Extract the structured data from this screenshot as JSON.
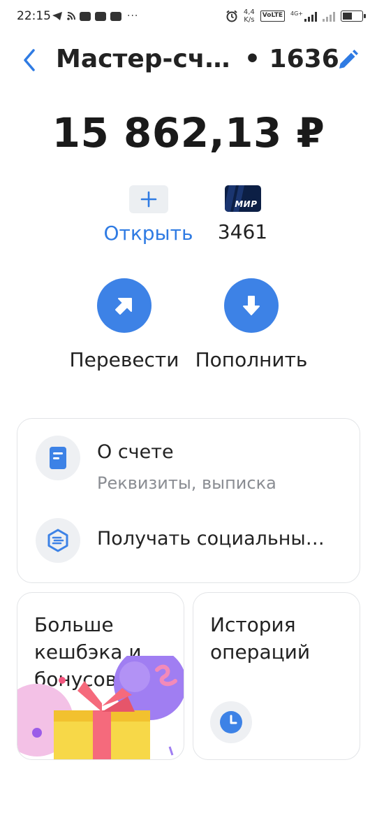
{
  "status_bar": {
    "time": "22:15",
    "speed_value": "4,4",
    "speed_unit": "K/s",
    "volte": "VoLTE",
    "network": "4G+",
    "battery_level_percent": 50
  },
  "header": {
    "title": "Мастер-сче…",
    "account_number": "• 1636"
  },
  "balance": "15 862,13 ₽",
  "cards": {
    "open_label": "Открыть",
    "mir_brand": "МИР",
    "mir_number": "3461"
  },
  "actions": {
    "transfer_label": "Перевести",
    "topup_label": "Пополнить"
  },
  "info": {
    "about_title": "О счете",
    "about_subtitle": "Реквизиты, выписка",
    "social_title": "Получать социальны…"
  },
  "tiles": {
    "cashback_title": "Больше кешбэка и бонусов",
    "history_title": "История операций"
  },
  "colors": {
    "accent": "#3d82e6",
    "link": "#2f7be3",
    "text": "#222222",
    "muted": "#8a8d93"
  }
}
